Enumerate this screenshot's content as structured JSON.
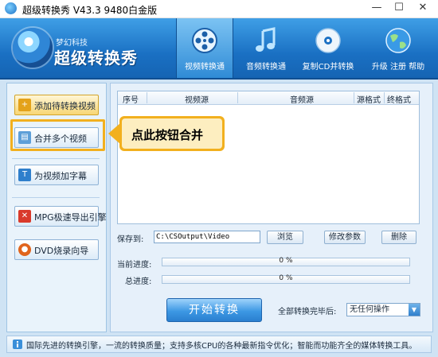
{
  "window": {
    "title": "超级转换秀 V43.3 9480白金版",
    "minimize": "—",
    "maximize": "☐",
    "close": "✕"
  },
  "header": {
    "brand_sub": "梦幻科技",
    "brand_title": "超级转换秀",
    "nav": [
      {
        "label": "视频转换通",
        "icon": "film-reel-icon",
        "active": true
      },
      {
        "label": "音频转换通",
        "icon": "music-note-icon"
      },
      {
        "label": "复制CD并转换",
        "icon": "cd-disc-icon"
      },
      {
        "label": "升级 注册 帮助",
        "icon": "globe-icon"
      }
    ]
  },
  "sidebar": {
    "items": [
      {
        "label": "添加待转换视频",
        "icon": "add-video-icon"
      },
      {
        "label": "合并多个视频",
        "icon": "merge-icon"
      },
      {
        "label": "为视频加字幕",
        "icon": "subtitle-icon"
      },
      {
        "label": "MPG极速导出引擎",
        "icon": "mpg-icon"
      },
      {
        "label": "DVD烧录向导",
        "icon": "dvd-burn-icon"
      }
    ]
  },
  "callout": {
    "text": "点此按钮合并"
  },
  "table": {
    "columns": [
      "序号",
      "视频源",
      "音频源",
      "源格式",
      "终格式"
    ],
    "rows": []
  },
  "output": {
    "save_label": "保存到:",
    "path": "C:\\CSOutput\\Video",
    "browse": "浏览",
    "edit_params": "修改参数",
    "delete": "删除"
  },
  "progress": {
    "current_label": "当前进度:",
    "current_text": "0 %",
    "current_value": 0,
    "total_label": "总进度:",
    "total_text": "0 %",
    "total_value": 0
  },
  "actions": {
    "start": "开始转换",
    "after_label": "全部转换完毕后:",
    "after_value": "无任何操作"
  },
  "status": {
    "text": "国际先进的转换引擎，一流的转换质量；支持多核CPU的各种最新指令优化；智能而功能齐全的媒体转换工具。"
  },
  "colors": {
    "accent": "#1a70c3",
    "highlight": "#f2b01e",
    "callout_bg": "#fdeec0"
  }
}
